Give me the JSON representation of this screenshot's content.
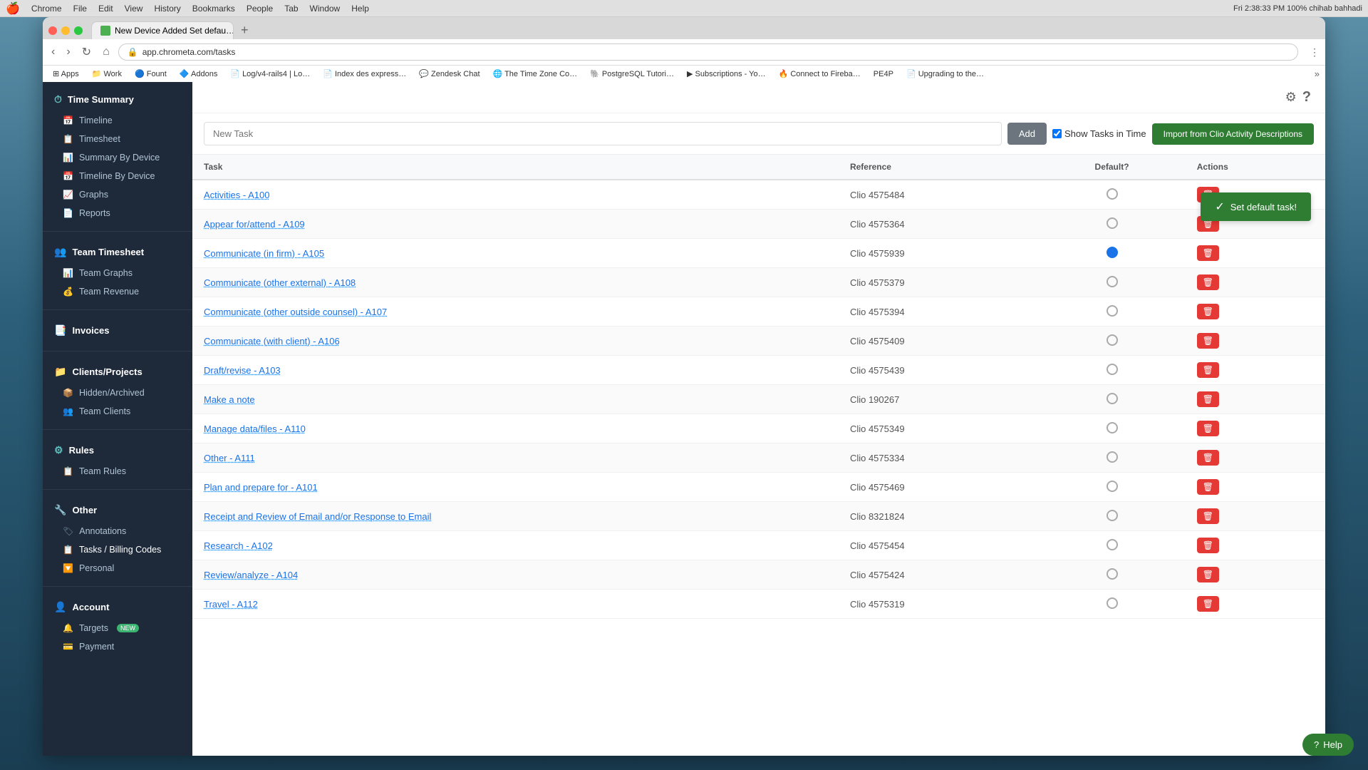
{
  "mac_bar": {
    "apple": "🍎",
    "items": [
      "Chrome",
      "File",
      "Edit",
      "View",
      "History",
      "Bookmarks",
      "People",
      "Tab",
      "Window",
      "Help"
    ],
    "right": "Fri 2:38:33 PM   100%   chihab bahhadi"
  },
  "browser": {
    "tab_title": "New Device Added Set defau…",
    "url": "app.chrometa.com/tasks",
    "bookmarks": [
      "Apps",
      "Work",
      "Fount",
      "Addons",
      "Log/v4-rails4 | Lo…",
      "Index des express…",
      "Zendesk Chat",
      "The Time Zone Co…",
      "PostgreSQL Tutori…",
      "Subscriptions - Yo…",
      "Connect to Fireba…",
      "PE4P",
      "Upgrading to the…"
    ]
  },
  "toolbar": {
    "gear_icon": "⚙",
    "help_icon": "?"
  },
  "task_input": {
    "placeholder": "New Task",
    "add_label": "Add",
    "show_tasks_label": "Show Tasks in Time",
    "import_label": "Import from Clio Activity Descriptions"
  },
  "success_notification": {
    "message": "Set default task!"
  },
  "table": {
    "columns": [
      "Task",
      "Reference",
      "Default?",
      "Actions"
    ],
    "rows": [
      {
        "task": "Activities - A100",
        "reference": "Clio 4575484",
        "default": false
      },
      {
        "task": "Appear for/attend - A109",
        "reference": "Clio 4575364",
        "default": false
      },
      {
        "task": "Communicate (in firm) - A105",
        "reference": "Clio 4575939",
        "default": true
      },
      {
        "task": "Communicate (other external) - A108",
        "reference": "Clio 4575379",
        "default": false
      },
      {
        "task": "Communicate (other outside counsel) - A107",
        "reference": "Clio 4575394",
        "default": false
      },
      {
        "task": "Communicate (with client) - A106",
        "reference": "Clio 4575409",
        "default": false
      },
      {
        "task": "Draft/revise - A103",
        "reference": "Clio 4575439",
        "default": false
      },
      {
        "task": "Make a note",
        "reference": "Clio 190267",
        "default": false
      },
      {
        "task": "Manage data/files - A110",
        "reference": "Clio 4575349",
        "default": false
      },
      {
        "task": "Other - A111",
        "reference": "Clio 4575334",
        "default": false
      },
      {
        "task": "Plan and prepare for - A101",
        "reference": "Clio 4575469",
        "default": false
      },
      {
        "task": "Receipt and Review of Email and/or Response to Email",
        "reference": "Clio 8321824",
        "default": false
      },
      {
        "task": "Research - A102",
        "reference": "Clio 4575454",
        "default": false
      },
      {
        "task": "Review/analyze - A104",
        "reference": "Clio 4575424",
        "default": false
      },
      {
        "task": "Travel - A112",
        "reference": "Clio 4575319",
        "default": false
      }
    ]
  },
  "sidebar": {
    "time_summary": {
      "label": "Time Summary",
      "icon": "⏱",
      "items": [
        {
          "label": "Timeline",
          "icon": "📅"
        },
        {
          "label": "Timesheet",
          "icon": "📋"
        },
        {
          "label": "Summary By Device",
          "icon": "📊"
        },
        {
          "label": "Timeline By Device",
          "icon": "📅"
        },
        {
          "label": "Graphs",
          "icon": "📈"
        },
        {
          "label": "Reports",
          "icon": "📄"
        }
      ]
    },
    "team_timesheet": {
      "label": "Team Timesheet",
      "icon": "👥",
      "items": [
        {
          "label": "Team Graphs",
          "icon": "📊"
        },
        {
          "label": "Team Revenue",
          "icon": "💰"
        }
      ]
    },
    "invoices": {
      "label": "Invoices",
      "icon": "📑"
    },
    "clients_projects": {
      "label": "Clients/Projects",
      "icon": "📁",
      "items": [
        {
          "label": "Hidden/Archived",
          "icon": "📦"
        },
        {
          "label": "Team Clients",
          "icon": "👥"
        }
      ]
    },
    "rules": {
      "label": "Rules",
      "icon": "⚙",
      "items": [
        {
          "label": "Team Rules",
          "icon": "📋"
        }
      ]
    },
    "other": {
      "label": "Other",
      "icon": "🔧",
      "items": [
        {
          "label": "Annotations",
          "icon": "🏷"
        },
        {
          "label": "Tasks / Billing Codes",
          "icon": "📋"
        },
        {
          "label": "Personal",
          "icon": "🔽"
        }
      ]
    },
    "account": {
      "label": "Account",
      "icon": "👤",
      "items": [
        {
          "label": "Targets",
          "icon": "🔔",
          "badge": "NEW"
        },
        {
          "label": "Payment",
          "icon": "💳"
        }
      ]
    }
  },
  "help_button": {
    "label": "Help",
    "icon": "?"
  }
}
